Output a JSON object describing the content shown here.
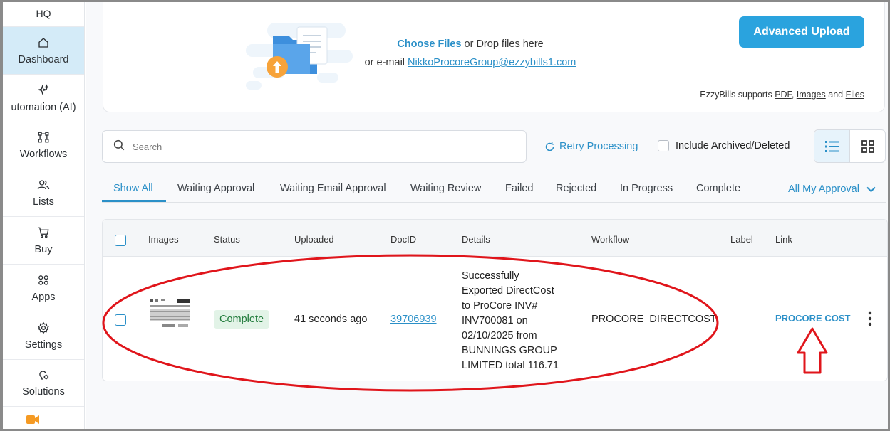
{
  "sidebar": {
    "top_label": "HQ",
    "items": [
      {
        "label": "Dashboard",
        "icon": "home-icon",
        "active": true
      },
      {
        "label": "utomation (AI)",
        "icon": "sparkle-icon",
        "active": false
      },
      {
        "label": "Workflows",
        "icon": "workflow-icon",
        "active": false
      },
      {
        "label": "Lists",
        "icon": "users-icon",
        "active": false
      },
      {
        "label": "Buy",
        "icon": "cart-icon",
        "active": false
      },
      {
        "label": "Apps",
        "icon": "apps-icon",
        "active": false
      },
      {
        "label": "Settings",
        "icon": "gear-icon",
        "active": false
      },
      {
        "label": "Solutions",
        "icon": "solutions-icon",
        "active": false
      }
    ]
  },
  "upload": {
    "choose_files": "Choose Files",
    "drop_text": "or Drop files here",
    "email_prefix": "or e-mail",
    "email": "NikkoProcoreGroup@ezzybills1.com",
    "advanced_upload": "Advanced Upload",
    "supports_prefix": "EzzyBills supports",
    "pdf": "PDF",
    "images": "Images",
    "and": "and",
    "files": "Files"
  },
  "toolbar": {
    "search_placeholder": "Search",
    "retry": "Retry Processing",
    "include_archived": "Include Archived/Deleted"
  },
  "tabs": {
    "items": [
      "Show All",
      "Waiting Approval",
      "Waiting Email Approval",
      "Waiting Review",
      "Failed",
      "Rejected",
      "In Progress",
      "Complete"
    ],
    "active": "Show All",
    "dropdown": "All My Approval"
  },
  "table": {
    "columns": [
      "Images",
      "Status",
      "Uploaded",
      "DocID",
      "Details",
      "Workflow",
      "Label",
      "Link"
    ],
    "rows": [
      {
        "status": "Complete",
        "uploaded": "41 seconds ago",
        "docid": "39706939",
        "details_lines": [
          "Successfully",
          "Exported DirectCost",
          "to ProCore INV#",
          "INV700081 on",
          "02/10/2025 from",
          "BUNNINGS GROUP",
          "LIMITED total 116.71"
        ],
        "workflow": "PROCORE_DIRECTCOST",
        "label": "",
        "link": "PROCORE COST"
      }
    ]
  },
  "colors": {
    "accent": "#2b90c8",
    "button": "#2aa3de",
    "sidebar_active": "#d4ebf8",
    "status_complete_bg": "#e2f3e7",
    "status_complete_text": "#1f7a3a",
    "annotation": "#e0151b"
  }
}
